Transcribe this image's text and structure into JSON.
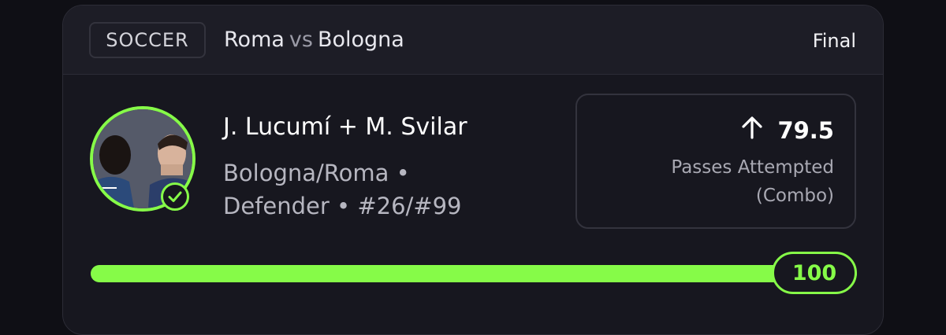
{
  "header": {
    "sport": "SOCCER",
    "team_home": "Roma",
    "vs": "vs",
    "team_away": "Bologna",
    "status": "Final"
  },
  "player": {
    "name": "J. Lucumí + M. Svilar",
    "meta": "Bologna/Roma • Defender • #26/#99",
    "avatar_icon": "player-photo",
    "status_icon": "check-circle-icon"
  },
  "stat": {
    "direction_icon": "arrow-up-icon",
    "line": "79.5",
    "label": "Passes Attempted (Combo)"
  },
  "progress": {
    "value_label": "100",
    "fraction": 1.0
  },
  "colors": {
    "accent": "#86fb48",
    "card_bg": "#17171f",
    "header_bg": "#1d1d26",
    "border": "#2c2c36",
    "muted_text": "#b6b6c0"
  }
}
